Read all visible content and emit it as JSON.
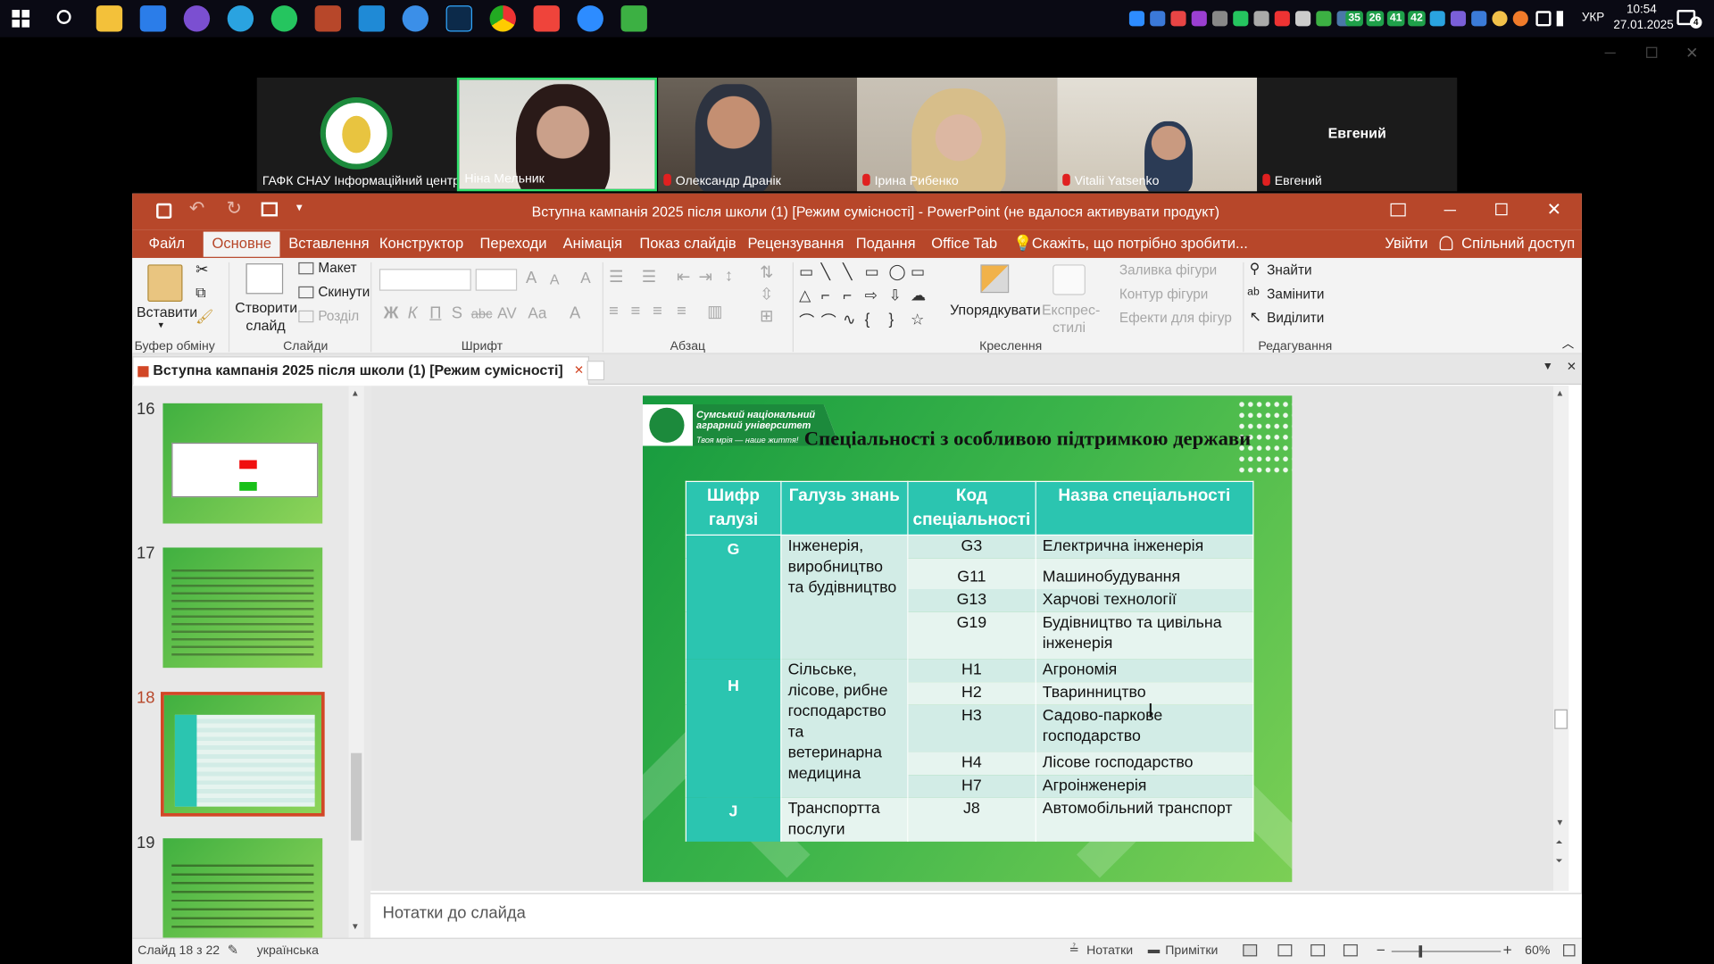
{
  "taskbar": {
    "tray_text": {
      "lang": "УКР",
      "time": "10:54",
      "date": "27.01.2025"
    },
    "tray_badges": [
      "35",
      "26",
      "41",
      "42"
    ],
    "notification_count": "4"
  },
  "meeting": {
    "tiles": [
      {
        "name": "ГАФК СНАУ Інформаційний центр",
        "muted": false
      },
      {
        "name": "Ніна Мельник",
        "muted": false
      },
      {
        "name": "Олександр Дранік",
        "muted": true
      },
      {
        "name": "Ірина Рибенко",
        "muted": true
      },
      {
        "name": "Vitalii Yatsenko",
        "muted": true
      },
      {
        "name": "Евгений",
        "muted": true,
        "center_label": "Евгений"
      }
    ]
  },
  "ppt": {
    "title": "Вступна кампанія 2025 після школи (1) [Режим сумісності] - PowerPoint (не вдалося активувати продукт)",
    "tabs": [
      "Файл",
      "Основне",
      "Вставлення",
      "Конструктор",
      "Переходи",
      "Анімація",
      "Показ слайдів",
      "Рецензування",
      "Подання",
      "Office Tab"
    ],
    "tell_me": "Скажіть, що потрібно зробити...",
    "signin": "Увійти",
    "share": "Спільний доступ",
    "ribbon": {
      "paste": "Вставити",
      "new_slide": "Створити слайд",
      "layout": "Макет",
      "reset": "Скинути",
      "section": "Розділ",
      "arrange": "Упорядкувати",
      "quick_styles": "Експрес-стилі",
      "shape_fill": "Заливка фігури",
      "shape_outline": "Контур фігури",
      "shape_effects": "Ефекти для фігур",
      "find": "Знайти",
      "replace": "Замінити",
      "select": "Виділити",
      "groups": [
        "Буфер обміну",
        "Слайди",
        "Шрифт",
        "Абзац",
        "Креслення",
        "Редагування"
      ]
    },
    "doc_tab": "Вступна кампанія 2025 після школи (1) [Режим сумісності]",
    "thumbnails": [
      "16",
      "17",
      "18",
      "19"
    ],
    "notes_placeholder": "Нотатки до слайда",
    "status": {
      "slide": "Слайд 18 з 22",
      "language": "українська",
      "notes": "Нотатки",
      "comments": "Примітки",
      "zoom": "60%"
    }
  },
  "slide": {
    "university": "Сумський національний аграрний університет",
    "slogan": "Твоя мрія — наше життя!",
    "title": "Спеціальності з особливою підтримкою держави",
    "headers": [
      "Шифр галузі",
      "Галузь знань",
      "Код спеціальності",
      "Назва спеціальності"
    ],
    "groups": [
      {
        "code": "G",
        "field": "Інженерія, виробництво та будівництво",
        "rows": [
          {
            "code": "G3",
            "name": "Електрична інженерія"
          },
          {
            "code": "G11",
            "name": "Машинобудування"
          },
          {
            "code": "G13",
            "name": "Харчові технології"
          },
          {
            "code": "G19",
            "name": "Будівництво та цивільна інженерія"
          }
        ]
      },
      {
        "code": "H",
        "field": "Сільське, лісове, рибне господарство та ветеринарна медицина",
        "rows": [
          {
            "code": "H1",
            "name": "Агрономія"
          },
          {
            "code": "H2",
            "name": "Тваринництво"
          },
          {
            "code": "H3",
            "name": "Садово-паркове господарство"
          },
          {
            "code": "H4",
            "name": "Лісове господарство"
          },
          {
            "code": "H7",
            "name": "Агроінженерія"
          }
        ]
      },
      {
        "code": "J",
        "field": "Транспортта послуги",
        "rows": [
          {
            "code": "J8",
            "name": "Автомобільний транспорт"
          }
        ]
      }
    ]
  }
}
